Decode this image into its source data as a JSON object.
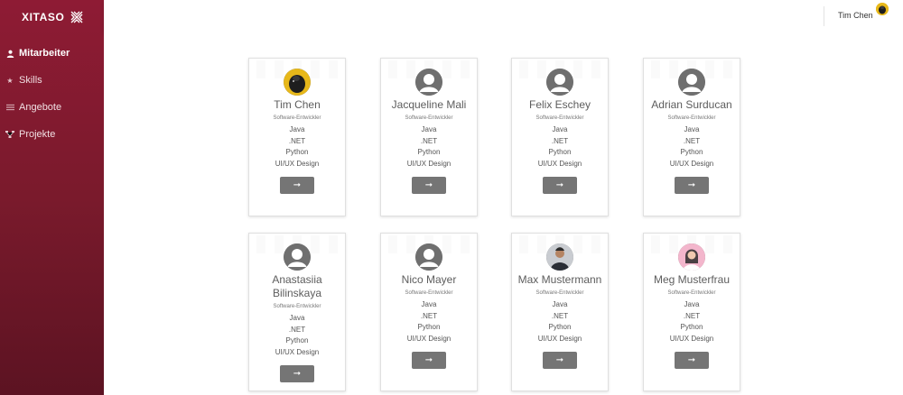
{
  "brand": {
    "name": "XITASO",
    "logo_icon": "xitaso-x-logo"
  },
  "sidebar": {
    "items": [
      {
        "label": "Mitarbeiter",
        "icon": "person-icon",
        "active": true
      },
      {
        "label": "Skills",
        "icon": "star-icon",
        "active": false
      },
      {
        "label": "Angebote",
        "icon": "list-icon",
        "active": false
      },
      {
        "label": "Projekte",
        "icon": "hierarchy-icon",
        "active": false
      }
    ]
  },
  "header": {
    "user_name": "Tim Chen"
  },
  "colors": {
    "sidebar_top": "#8e1b34",
    "sidebar_bottom": "#5c1322",
    "button": "#757575"
  },
  "cards": [
    {
      "name": "Tim Chen",
      "role": "Software-Entwickler",
      "skills": [
        "Java",
        ".NET",
        "Python",
        "UI/UX Design"
      ],
      "button": "➞",
      "avatar": "photo-yellow"
    },
    {
      "name": "Jacqueline Mali",
      "role": "Software-Entwickler",
      "skills": [
        "Java",
        ".NET",
        "Python",
        "UI/UX Design"
      ],
      "button": "➞",
      "avatar": "placeholder"
    },
    {
      "name": "Felix Eschey",
      "role": "Software-Entwickler",
      "skills": [
        "Java",
        ".NET",
        "Python",
        "UI/UX Design"
      ],
      "button": "➞",
      "avatar": "placeholder"
    },
    {
      "name": "Adrian Surducan",
      "role": "Software-Entwickler",
      "skills": [
        "Java",
        ".NET",
        "Python",
        "UI/UX Design"
      ],
      "button": "➞",
      "avatar": "placeholder"
    },
    {
      "name": "Anastasiia Bilinskaya",
      "role": "Software-Entwickler",
      "skills": [
        "Java",
        ".NET",
        "Python",
        "UI/UX Design"
      ],
      "button": "➞",
      "avatar": "placeholder"
    },
    {
      "name": "Nico Mayer",
      "role": "Software-Entwickler",
      "skills": [
        "Java",
        ".NET",
        "Python",
        "UI/UX Design"
      ],
      "button": "➞",
      "avatar": "placeholder"
    },
    {
      "name": "Max Mustermann",
      "role": "Software-Entwickler",
      "skills": [
        "Java",
        ".NET",
        "Python",
        "UI/UX Design"
      ],
      "button": "➞",
      "avatar": "photo-man"
    },
    {
      "name": "Meg Musterfrau",
      "role": "Software-Entwickler",
      "skills": [
        "Java",
        ".NET",
        "Python",
        "UI/UX Design"
      ],
      "button": "➞",
      "avatar": "photo-woman"
    }
  ]
}
